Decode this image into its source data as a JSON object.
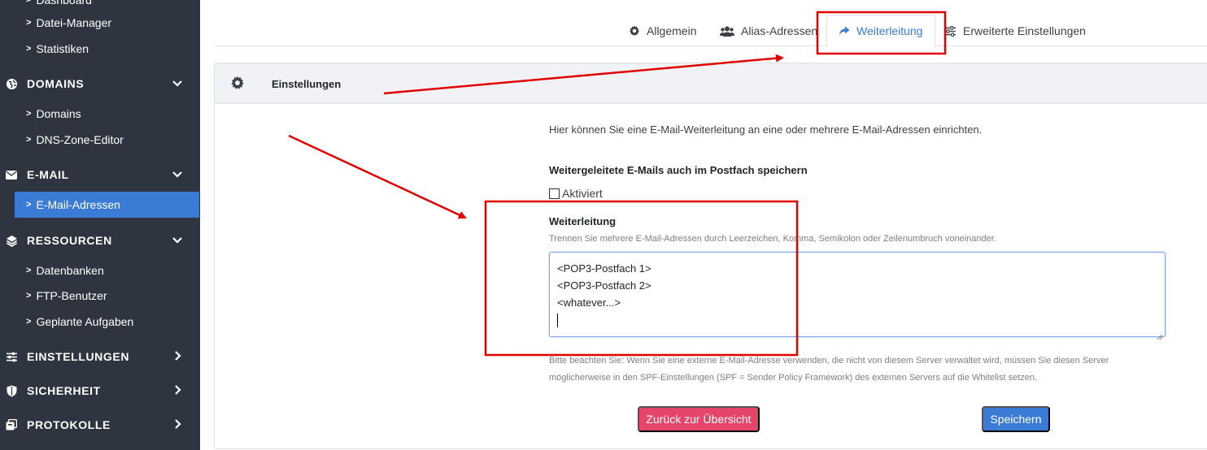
{
  "sidebar": {
    "items": [
      {
        "label": "Dashboard"
      },
      {
        "label": "Datei-Manager"
      },
      {
        "label": "Statistiken"
      },
      {
        "label": "DOMAINS"
      },
      {
        "label": "Domains"
      },
      {
        "label": "DNS-Zone-Editor"
      },
      {
        "label": "E-MAIL"
      },
      {
        "label": "E-Mail-Adressen"
      },
      {
        "label": "RESSOURCEN"
      },
      {
        "label": "Datenbanken"
      },
      {
        "label": "FTP-Benutzer"
      },
      {
        "label": "Geplante Aufgaben"
      },
      {
        "label": "EINSTELLUNGEN"
      },
      {
        "label": "SICHERHEIT"
      },
      {
        "label": "PROTOKOLLE"
      }
    ]
  },
  "tabs": [
    {
      "label": "Allgemein",
      "icon": "gear-icon"
    },
    {
      "label": "Alias-Adressen",
      "icon": "users-icon"
    },
    {
      "label": "Weiterleitung",
      "icon": "share-icon",
      "active": true
    },
    {
      "label": "Erweiterte Einstellungen",
      "icon": "sliders-icon"
    }
  ],
  "card": {
    "title": "Einstellungen"
  },
  "form": {
    "intro": "Hier können Sie eine E-Mail-Weiterleitung an eine oder mehrere E-Mail-Adressen einrichten.",
    "store_label": "Weitergeleitete E-Mails auch im Postfach speichern",
    "checkbox_label": "Aktiviert",
    "forward_label": "Weiterleitung",
    "forward_hint": "Trennen Sie mehrere E-Mail-Adressen durch Leerzeichen, Komma, Semikolon oder Zeilenumbruch voneinander.",
    "textarea_lines": [
      "<POP3-Postfach 1>",
      "<POP3-Postfach 2>",
      "<whatever...>"
    ],
    "warning_line1": "Bitte beachten Sie: Wenn Sie eine externe E-Mail-Adresse verwenden, die nicht von diesem Server verwaltet wird, müssen Sie diesen Server",
    "warning_line2": "möglicherweise in den SPF-Einstellungen (SPF = Sender Policy Framework) des externen Servers auf die Whitelist setzen."
  },
  "buttons": {
    "back": "Zurück zur Übersicht",
    "save": "Speichern"
  },
  "colors": {
    "sidebar_bg": "#2f3540",
    "accent": "#3a7bd5",
    "danger": "#e6456a",
    "annotation": "#e00000"
  }
}
